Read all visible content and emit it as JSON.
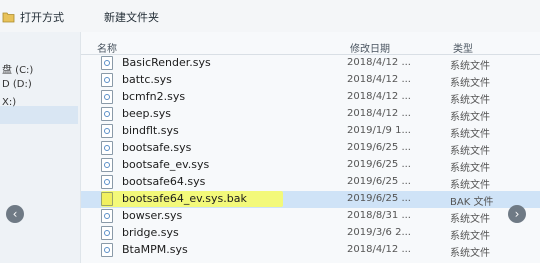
{
  "toolbar": {
    "open_label": "打开方式",
    "new_folder_label": "新建文件夹",
    "open_icon": "folder-open-icon"
  },
  "nav": {
    "items": [
      {
        "label": "盘 (C:)"
      },
      {
        "label": "D (D:)"
      },
      {
        "label": "X:)"
      }
    ]
  },
  "columns": {
    "name": "名称",
    "date": "修改日期",
    "type": "类型"
  },
  "files": [
    {
      "name": "BasicRender.sys",
      "date": "2018/4/12 ...",
      "type": "系统文件"
    },
    {
      "name": "battc.sys",
      "date": "2018/4/12 ...",
      "type": "系统文件"
    },
    {
      "name": "bcmfn2.sys",
      "date": "2018/4/12 ...",
      "type": "系统文件"
    },
    {
      "name": "beep.sys",
      "date": "2018/4/12 ...",
      "type": "系统文件"
    },
    {
      "name": "bindflt.sys",
      "date": "2019/1/9 1...",
      "type": "系统文件"
    },
    {
      "name": "bootsafe.sys",
      "date": "2019/6/25 ...",
      "type": "系统文件"
    },
    {
      "name": "bootsafe_ev.sys",
      "date": "2019/6/25 ...",
      "type": "系统文件"
    },
    {
      "name": "bootsafe64.sys",
      "date": "2019/6/25 ...",
      "type": "系统文件"
    },
    {
      "name": "bootsafe64_ev.sys.bak",
      "date": "2019/6/25 ...",
      "type": "BAK 文件",
      "selected": true
    },
    {
      "name": "bowser.sys",
      "date": "2018/8/31 ...",
      "type": "系统文件"
    },
    {
      "name": "bridge.sys",
      "date": "2019/3/6 2...",
      "type": "系统文件"
    },
    {
      "name": "BtaMPM.sys",
      "date": "2018/4/12 ...",
      "type": "系统文件"
    }
  ],
  "nav_arrows": {
    "left": "‹",
    "right": "›"
  }
}
